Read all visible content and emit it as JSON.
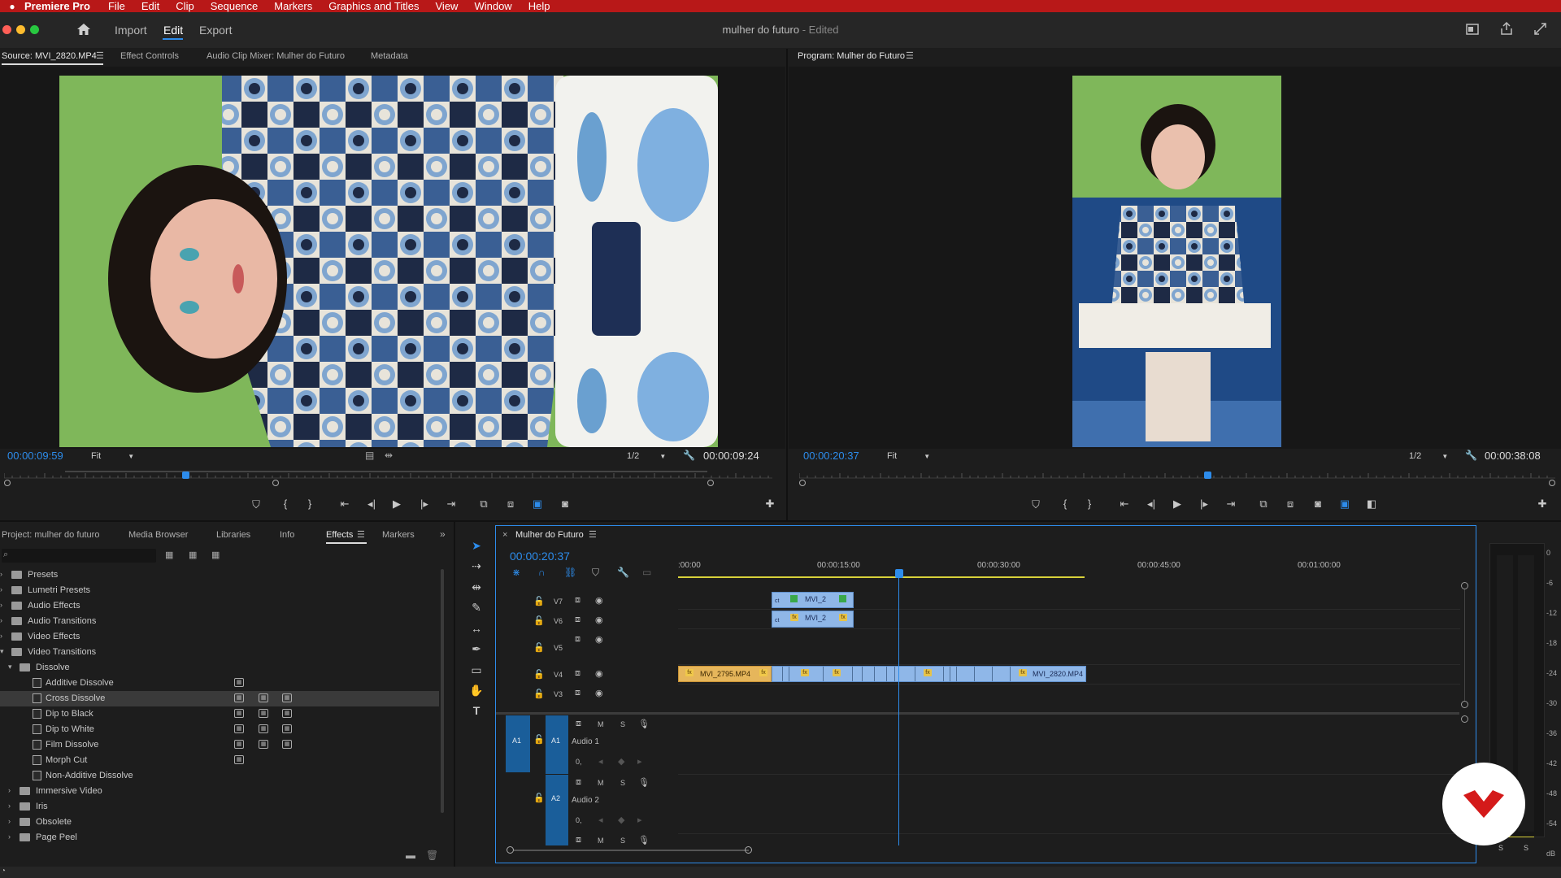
{
  "menubar": {
    "app": "Premiere Pro",
    "items": [
      "File",
      "Edit",
      "Clip",
      "Sequence",
      "Markers",
      "Graphics and Titles",
      "View",
      "Window",
      "Help"
    ]
  },
  "header": {
    "tabs": [
      "Import",
      "Edit",
      "Export"
    ],
    "active_tab": "Edit",
    "doc_title": "mulher do futuro",
    "doc_status": "- Edited"
  },
  "source_monitor": {
    "tabs": [
      "Source: MVI_2820.MP4",
      "Effect Controls",
      "Audio Clip Mixer: Mulher do Futuro",
      "Metadata"
    ],
    "timecode": "00:00:09:59",
    "zoom": "Fit",
    "resolution": "1/2",
    "duration": "00:00:09:24",
    "playhead_fraction": 0.185
  },
  "program_monitor": {
    "title": "Program: Mulher do Futuro",
    "timecode": "00:00:20:37",
    "zoom": "Fit",
    "resolution": "1/2",
    "duration": "00:00:38:08",
    "playhead_fraction": 0.537
  },
  "effects_panel": {
    "tabs": [
      "Project: mulher do futuro",
      "Media Browser",
      "Libraries",
      "Info",
      "Effects",
      "Markers"
    ],
    "active_tab": "Effects",
    "tree": [
      {
        "label": "Presets",
        "level": 0,
        "type": "folder",
        "expanded": false
      },
      {
        "label": "Lumetri Presets",
        "level": 0,
        "type": "folder",
        "expanded": false
      },
      {
        "label": "Audio Effects",
        "level": 0,
        "type": "folder",
        "expanded": false
      },
      {
        "label": "Audio Transitions",
        "level": 0,
        "type": "folder",
        "expanded": false
      },
      {
        "label": "Video Effects",
        "level": 0,
        "type": "folder",
        "expanded": false
      },
      {
        "label": "Video Transitions",
        "level": 0,
        "type": "folder",
        "expanded": true
      },
      {
        "label": "Dissolve",
        "level": 1,
        "type": "folder",
        "expanded": true
      },
      {
        "label": "Additive Dissolve",
        "level": 2,
        "type": "effect",
        "badges": 1
      },
      {
        "label": "Cross Dissolve",
        "level": 2,
        "type": "effect",
        "badges": 3,
        "selected": true
      },
      {
        "label": "Dip to Black",
        "level": 2,
        "type": "effect",
        "badges": 3
      },
      {
        "label": "Dip to White",
        "level": 2,
        "type": "effect",
        "badges": 3
      },
      {
        "label": "Film Dissolve",
        "level": 2,
        "type": "effect",
        "badges": 3
      },
      {
        "label": "Morph Cut",
        "level": 2,
        "type": "effect",
        "badges": 1
      },
      {
        "label": "Non-Additive Dissolve",
        "level": 2,
        "type": "effect",
        "badges": 0
      },
      {
        "label": "Immersive Video",
        "level": 1,
        "type": "folder",
        "expanded": false
      },
      {
        "label": "Iris",
        "level": 1,
        "type": "folder",
        "expanded": false
      },
      {
        "label": "Obsolete",
        "level": 1,
        "type": "folder",
        "expanded": false
      },
      {
        "label": "Page Peel",
        "level": 1,
        "type": "folder",
        "expanded": false
      }
    ]
  },
  "timeline": {
    "sequence_name": "Mulher do Futuro",
    "timecode": "00:00:20:37",
    "ruler": [
      ":00:00",
      "00:00:15:00",
      "00:00:30:00",
      "00:00:45:00",
      "00:01:00:00"
    ],
    "video_tracks": [
      "V7",
      "V6",
      "V5",
      "V4",
      "V3"
    ],
    "audio_tracks": [
      {
        "id": "A1",
        "name": "Audio 1"
      },
      {
        "id": "A2",
        "name": "Audio 2"
      }
    ],
    "track_buttons": {
      "mute": "M",
      "solo": "S",
      "volume": "0,"
    },
    "clips": {
      "v7": "MVI_2",
      "v6": "MVI_2",
      "v4_a": "MVI_2795.MP4",
      "v4_b": "MVI_2820.MP4"
    }
  },
  "meter": {
    "labels": [
      "0",
      "-6",
      "-12",
      "-18",
      "-24",
      "-30",
      "-36",
      "-42",
      "-48",
      "-54",
      "dB"
    ],
    "solo_labels": [
      "S",
      "S"
    ]
  },
  "colors": {
    "accent": "#2d8ceb",
    "menubar": "#b81818",
    "clip_blue": "#8fb7e8",
    "clip_yellow": "#e6b65b"
  }
}
